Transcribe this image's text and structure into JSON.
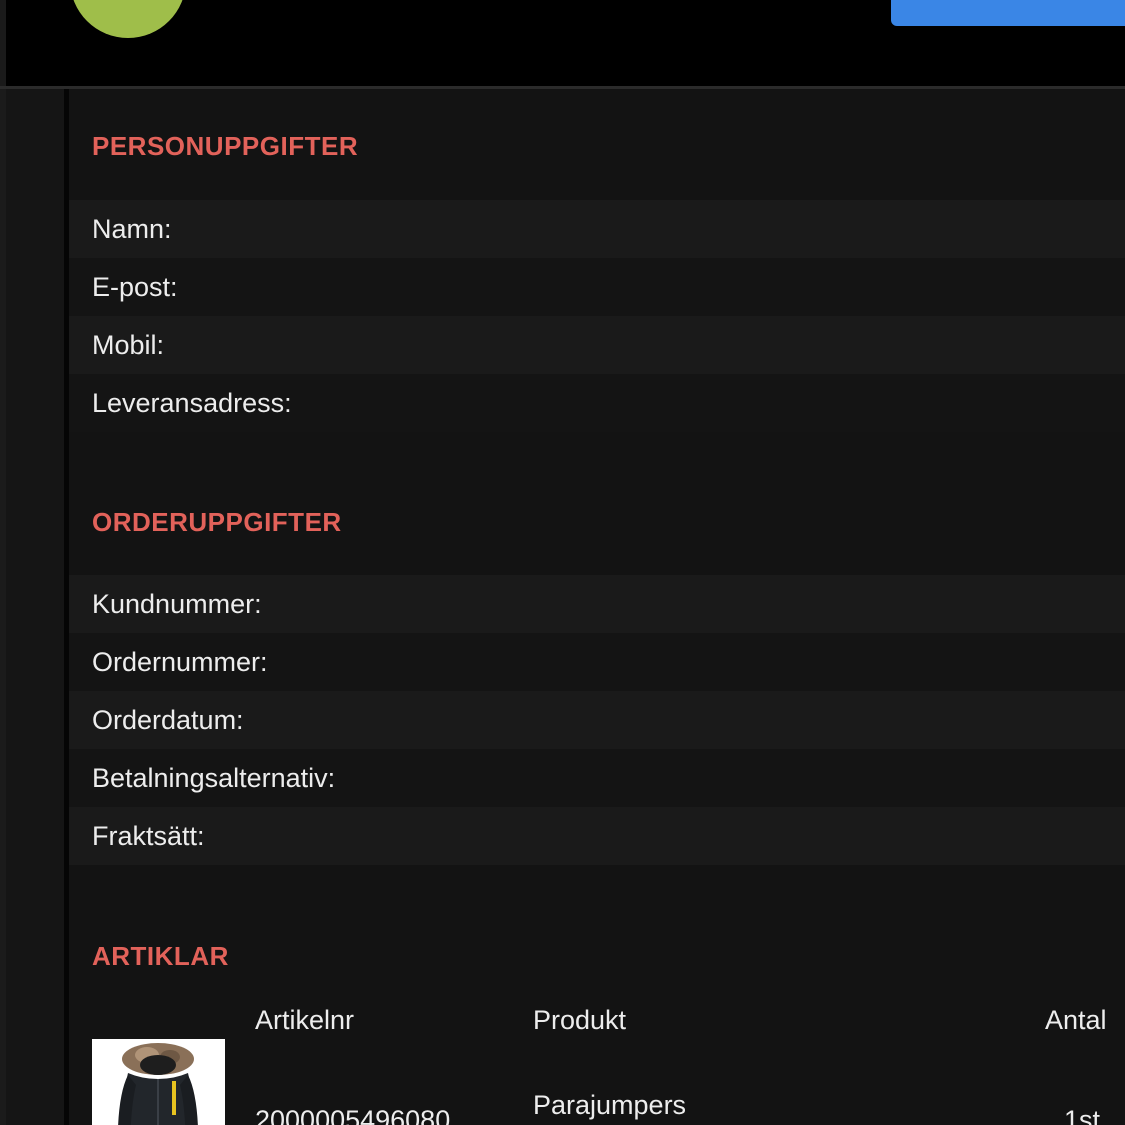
{
  "header": {
    "title": "",
    "button_label": ""
  },
  "personal": {
    "title": "PERSONUPPGIFTER",
    "fields": [
      {
        "label": "Namn:"
      },
      {
        "label": "E-post:"
      },
      {
        "label": "Mobil:"
      },
      {
        "label": "Leveransadress:"
      }
    ]
  },
  "order": {
    "title": "ORDERUPPGIFTER",
    "fields": [
      {
        "label": "Kundnummer:"
      },
      {
        "label": "Ordernummer:"
      },
      {
        "label": "Orderdatum:"
      },
      {
        "label": "Betalningsalternativ:"
      },
      {
        "label": "Fraktsätt:"
      }
    ]
  },
  "articles": {
    "title": "ARTIKLAR",
    "columns": [
      "Artikelnr",
      "Produkt",
      "Antal"
    ],
    "items": [
      {
        "article_number": "2000005496080",
        "product": "Parajumpers",
        "quantity": "1st",
        "image": "jacket-image"
      }
    ]
  },
  "colors": {
    "accent": "#e2625a",
    "avatar": "#9fbe4a",
    "button": "#3a86e6"
  }
}
